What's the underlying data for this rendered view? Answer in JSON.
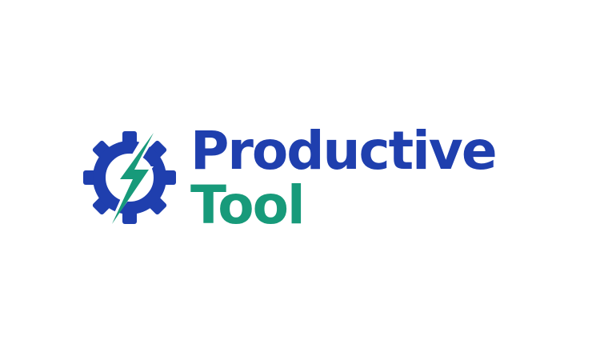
{
  "brand": {
    "line1": "Productive",
    "line2": "Tool"
  },
  "icons": {
    "mark": "gear-lightning-icon"
  },
  "colors": {
    "background": "#ffffff",
    "primary_blue": "#1f3fae",
    "accent_green": "#179a7a"
  }
}
